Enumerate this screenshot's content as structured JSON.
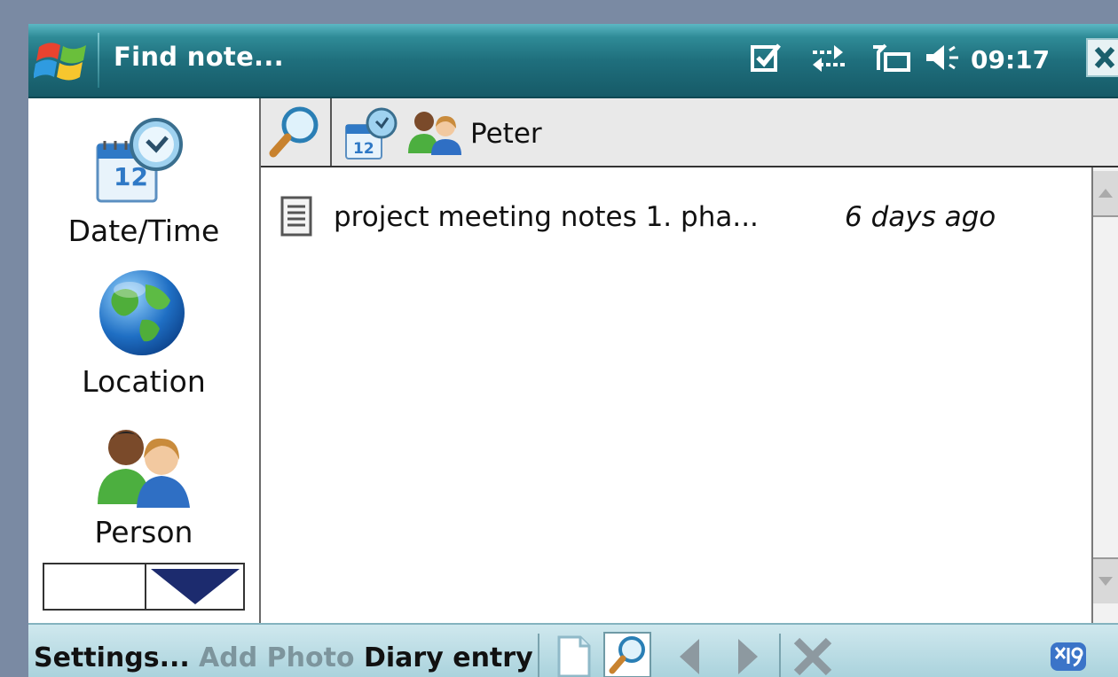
{
  "window": {
    "title": "Find note...",
    "clock": "09:17",
    "status_icons": [
      "checkbox-icon",
      "sync-icon",
      "signal-icon",
      "volume-icon"
    ]
  },
  "categories": [
    {
      "label": "Date/Time",
      "icon": "calendar-clock-icon"
    },
    {
      "label": "Location",
      "icon": "globe-icon"
    },
    {
      "label": "Person",
      "icon": "people-icon"
    }
  ],
  "filter": {
    "value": "Peter",
    "icons": [
      "search-icon",
      "calendar-clock-icon",
      "people-icon"
    ]
  },
  "results": [
    {
      "title": "project meeting notes 1. pha...",
      "date": "6 days ago",
      "icon": "document-icon"
    }
  ],
  "toolbar": {
    "settings_label": "Settings...",
    "add_photo_label": "Add Photo",
    "diary_label": "Diary entry",
    "buttons": [
      "new-note-icon",
      "search-icon",
      "arrow-left-icon",
      "arrow-right-icon",
      "delete-icon"
    ]
  },
  "colors": {
    "titlebar": "#1f6f7d",
    "toolbar": "#b8dce4",
    "disabled_text": "#7d959d",
    "background": "#7a8aa3"
  }
}
